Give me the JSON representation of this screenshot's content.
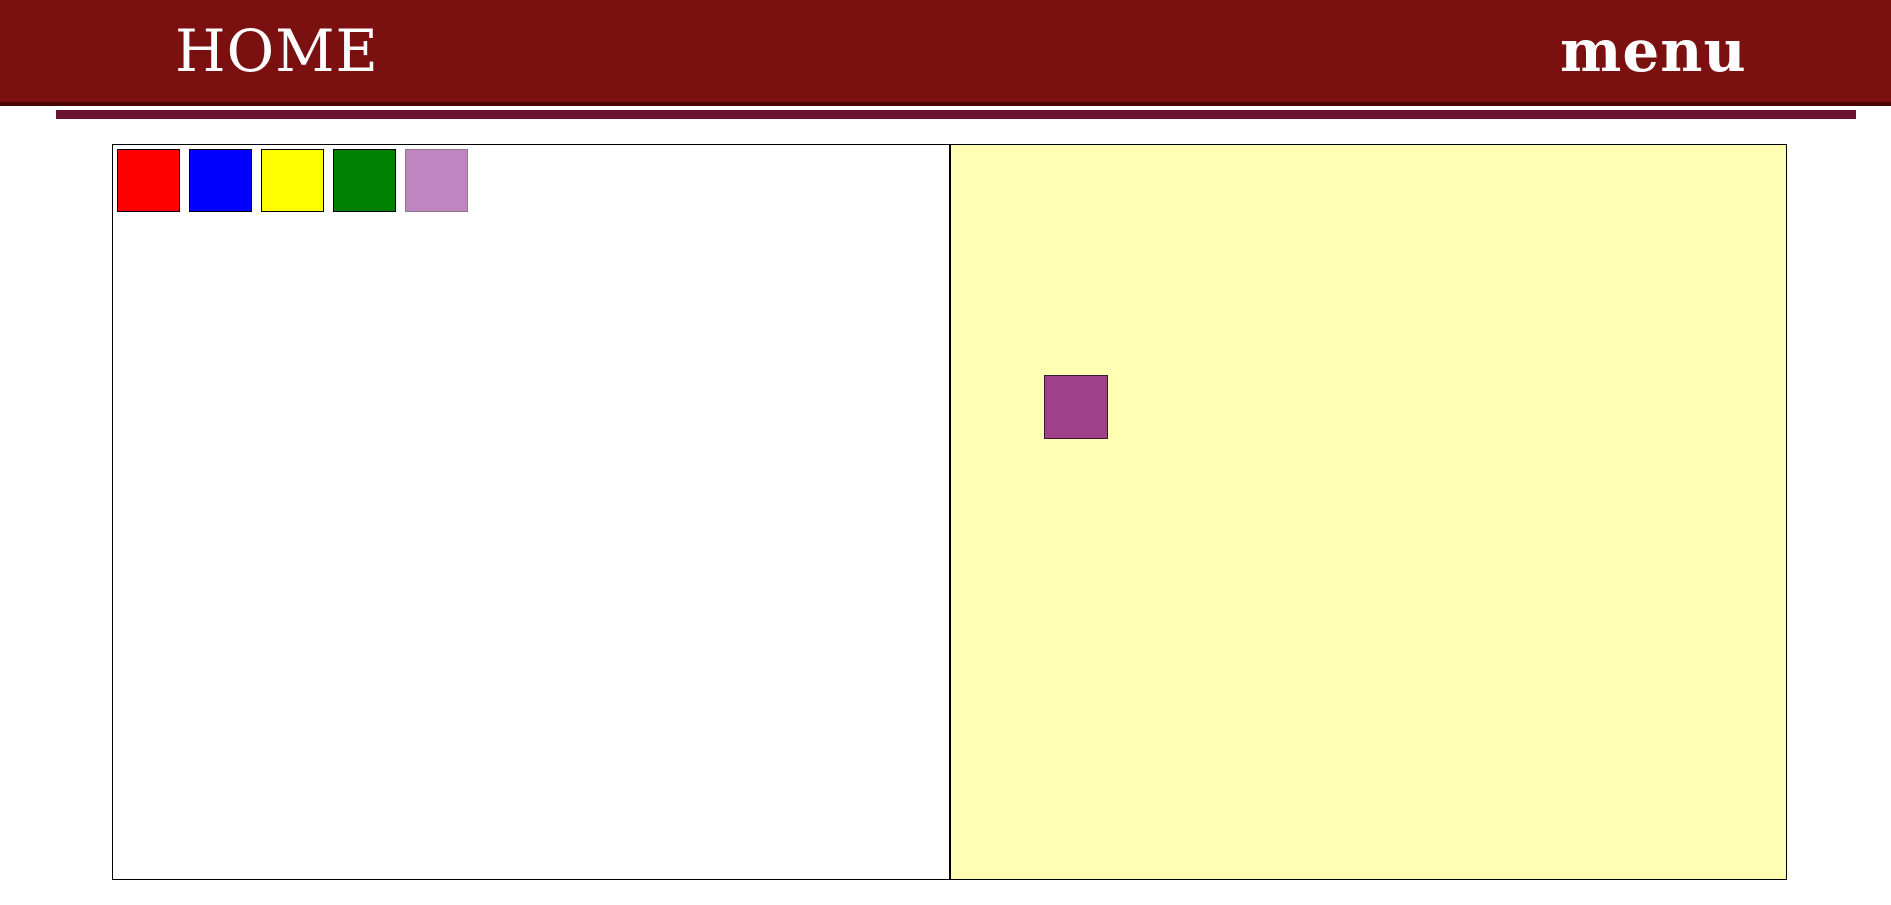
{
  "header": {
    "title": "HOME",
    "menu_label": "menu",
    "background_color": "#7a1010",
    "text_color": "#ffffff"
  },
  "palette": {
    "swatches": [
      {
        "name": "red",
        "color": "#ff0000"
      },
      {
        "name": "blue",
        "color": "#0000ff"
      },
      {
        "name": "yellow",
        "color": "#ffff00"
      },
      {
        "name": "green",
        "color": "#008000"
      },
      {
        "name": "lilac",
        "color": "#c084c0"
      }
    ]
  },
  "canvas": {
    "background_color": "#ffffb4",
    "placed_items": [
      {
        "name": "purple",
        "color": "#a0408a"
      }
    ]
  }
}
